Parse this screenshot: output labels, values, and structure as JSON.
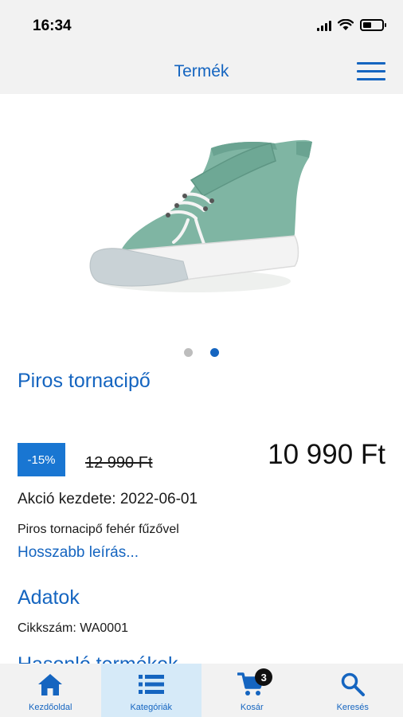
{
  "status_bar": {
    "time": "16:34"
  },
  "header": {
    "title": "Termék"
  },
  "product": {
    "title": "Piros tornacipő",
    "discount": "-15%",
    "old_price": "12 990 Ft",
    "new_price": "10 990 Ft",
    "sale_start": "Akció kezdete: 2022-06-01",
    "short_description": "Piros tornacipő fehér fűzővel",
    "more_link": "Hosszabb leírás...",
    "image_dots": {
      "count": 2,
      "active_index": 1
    }
  },
  "details": {
    "title": "Adatok",
    "sku": "Cikkszám: WA0001"
  },
  "similar": {
    "title": "Hasonló termékek"
  },
  "bottom_nav": {
    "items": [
      {
        "label": "Kezdőoldal",
        "icon": "home-icon"
      },
      {
        "label": "Kategóriák",
        "icon": "list-icon"
      },
      {
        "label": "Kosár",
        "icon": "cart-icon",
        "badge": "3"
      },
      {
        "label": "Keresés",
        "icon": "search-icon"
      }
    ],
    "active_index": 1
  },
  "colors": {
    "accent": "#1565c0",
    "badge": "#1976d2",
    "bar_background": "#f2f2f2",
    "nav_active": "#d6eaf8",
    "shoe": "#7fb5a3"
  }
}
